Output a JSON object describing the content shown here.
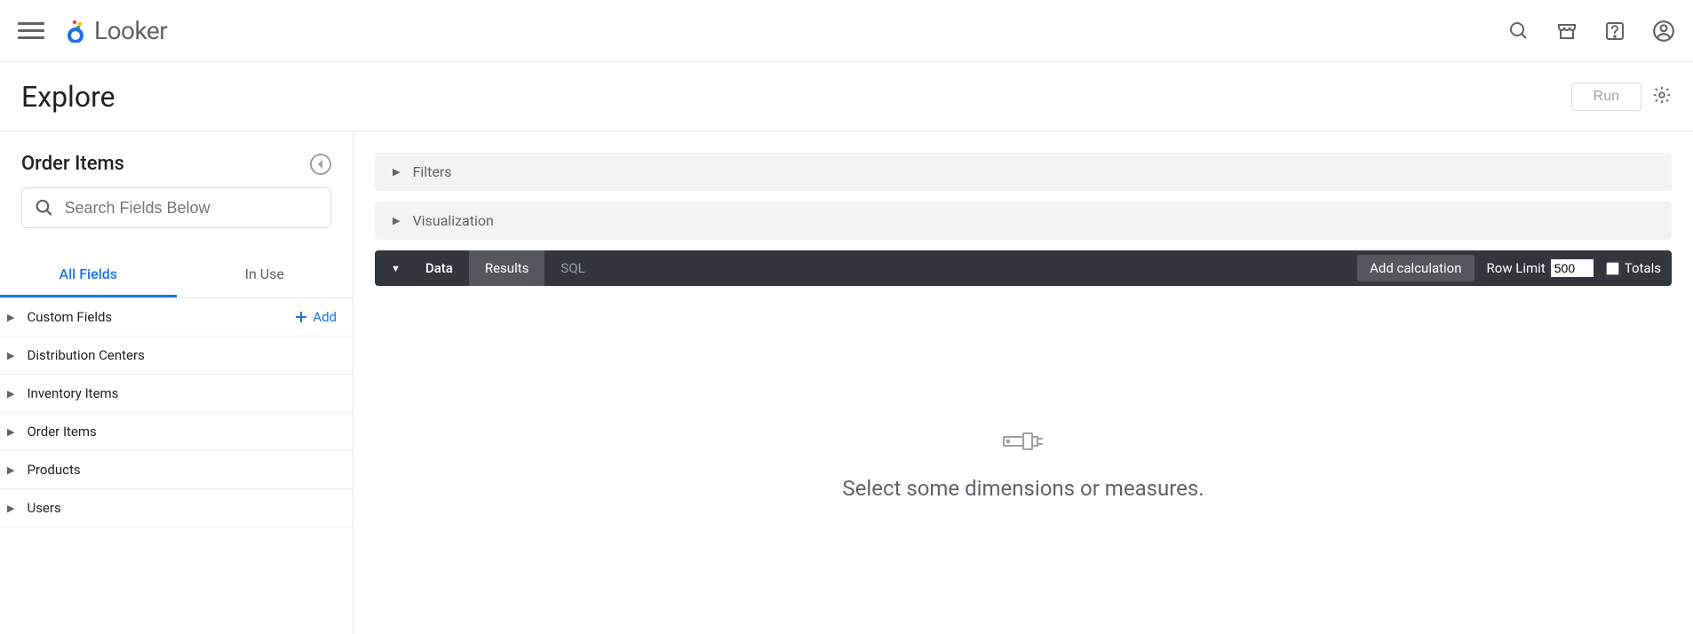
{
  "header": {
    "app_name": "Looker"
  },
  "explore": {
    "title": "Explore",
    "run_label": "Run"
  },
  "sidebar": {
    "explore_name": "Order Items",
    "search_placeholder": "Search Fields Below",
    "tabs": {
      "all_fields": "All Fields",
      "in_use": "In Use"
    },
    "add_label": "Add",
    "groups": [
      {
        "label": "Custom Fields",
        "has_add": true
      },
      {
        "label": "Distribution Centers"
      },
      {
        "label": "Inventory Items"
      },
      {
        "label": "Order Items"
      },
      {
        "label": "Products"
      },
      {
        "label": "Users"
      }
    ]
  },
  "panels": {
    "filters": "Filters",
    "visualization": "Visualization"
  },
  "databar": {
    "data": "Data",
    "results": "Results",
    "sql": "SQL",
    "add_calc": "Add calculation",
    "row_limit_label": "Row Limit",
    "row_limit_value": "500",
    "totals": "Totals"
  },
  "empty": {
    "message": "Select some dimensions or measures."
  }
}
